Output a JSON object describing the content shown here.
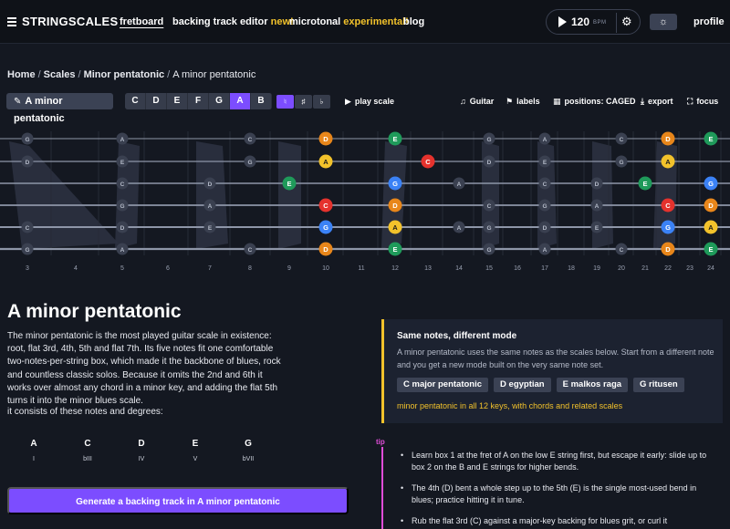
{
  "nav": {
    "brand": "STRINGSCALES",
    "links": [
      {
        "label": "fretboard",
        "highlight": "",
        "active": true
      },
      {
        "label": "backing track editor",
        "highlight": "new!",
        "active": false
      },
      {
        "label": "microtonal",
        "highlight": "experimental!",
        "active": false
      },
      {
        "label": "blog",
        "highlight": "",
        "active": false
      }
    ],
    "bpm": "120",
    "bpm_unit": "BPM",
    "profile": "profile"
  },
  "breadcrumb": [
    "Home",
    "Scales",
    "Minor pentatonic",
    "A minor pentatonic"
  ],
  "toolbar": {
    "scale_name": "A minor pentatonic",
    "keys": [
      "C",
      "D",
      "E",
      "F",
      "G",
      "A",
      "B"
    ],
    "active_key": "A",
    "accidentals": [
      "♮",
      "♯",
      "♭"
    ],
    "active_accidental": "♮",
    "play_label": "play scale",
    "instrument_label": "Guitar",
    "labels_label": "labels",
    "positions_label": "positions: CAGED",
    "export_label": "export",
    "focus_label": "focus"
  },
  "fretboard": {
    "fret_numbers": [
      "3",
      "4",
      "5",
      "6",
      "7",
      "8",
      "9",
      "10",
      "11",
      "12",
      "13",
      "14",
      "15",
      "16",
      "17",
      "18",
      "19",
      "20",
      "21",
      "22",
      "23",
      "24"
    ],
    "note_colors": {
      "A": "#f2c22b",
      "C": "#e5322d",
      "D": "#e8861a",
      "E": "#1f9a5a",
      "G": "#3b82f6"
    }
  },
  "main": {
    "title": "A minor pentatonic",
    "description": "The minor pentatonic is the most played guitar scale in existence: root, flat 3rd, 4th, 5th and flat 7th. Its five notes fit one comfortable two-notes-per-string box, which made it the backbone of blues, rock and countless classic solos. Because it omits the 2nd and 6th it works over almost any chord in a minor key, and adding the flat 5th turns it into the minor blues scale.",
    "notes_intro": "it consists of these notes and degrees:",
    "notes": [
      {
        "note": "A",
        "degree": "I"
      },
      {
        "note": "C",
        "degree": "bIII"
      },
      {
        "note": "D",
        "degree": "IV"
      },
      {
        "note": "E",
        "degree": "V"
      },
      {
        "note": "G",
        "degree": "bVII"
      }
    ],
    "generate_label": "Generate a backing track in A minor pentatonic"
  },
  "modes": {
    "title": "Same notes, different mode",
    "body": "A minor pentatonic uses the same notes as the scales below. Start from a different note and you get a new mode built on the very same note set.",
    "chips": [
      "C major pentatonic",
      "D egyptian",
      "E malkos raga",
      "G ritusen"
    ],
    "link": "minor pentatonic in all 12 keys, with chords and related scales"
  },
  "tips": {
    "label": "tip",
    "items": [
      "Learn box 1 at the fret of A on the low E string first, but escape it early: slide up to box 2 on the B and E strings for higher bends.",
      "The 4th (D) bent a whole step up to the 5th (E) is the single most-used bend in blues; practice hitting it in tune.",
      "Rub the flat 3rd (C) against a major-key backing for blues grit, or curl it"
    ]
  }
}
